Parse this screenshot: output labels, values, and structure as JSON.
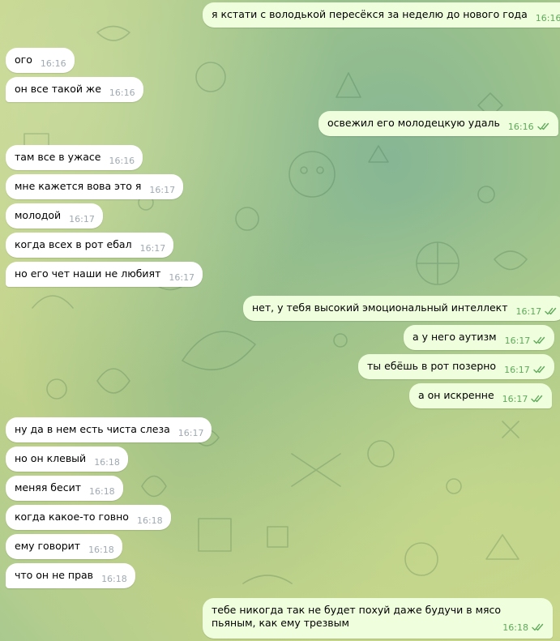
{
  "theme": {
    "incoming_bubble": "#ffffff",
    "outgoing_bubble": "#effedd",
    "incoming_time": "#a0aab2",
    "outgoing_time": "#5faa5a",
    "check_icon": "double-check-icon"
  },
  "messages": [
    {
      "dir": "out",
      "text": "я кстати с володькой пересёкся за неделю до нового года",
      "time": "16:16",
      "read": true
    },
    {
      "dir": "in",
      "text": "ого",
      "time": "16:16"
    },
    {
      "dir": "in",
      "text": "он все такой же",
      "time": "16:16"
    },
    {
      "dir": "out",
      "text": "освежил его молодецкую удаль",
      "time": "16:16",
      "read": true
    },
    {
      "dir": "in",
      "text": "там все в ужасе",
      "time": "16:16"
    },
    {
      "dir": "in",
      "text": "мне кажется вова это я",
      "time": "16:17"
    },
    {
      "dir": "in",
      "text": "молодой",
      "time": "16:17"
    },
    {
      "dir": "in",
      "text": "когда всех в рот ебал",
      "time": "16:17"
    },
    {
      "dir": "in",
      "text": "но его чет наши не любият",
      "time": "16:17"
    },
    {
      "dir": "out",
      "text": "нет, у тебя высокий эмоциональный интеллект",
      "time": "16:17",
      "read": true
    },
    {
      "dir": "out",
      "text": "а у него аутизм",
      "time": "16:17",
      "read": true
    },
    {
      "dir": "out",
      "text": "ты ебёшь в рот позерно",
      "time": "16:17",
      "read": true
    },
    {
      "dir": "out",
      "text": "а он искренне",
      "time": "16:17",
      "read": true
    },
    {
      "dir": "in",
      "text": "ну да в нем есть чиста слеза",
      "time": "16:17"
    },
    {
      "dir": "in",
      "text": "но он клевый",
      "time": "16:18"
    },
    {
      "dir": "in",
      "text": "меняя бесит",
      "time": "16:18"
    },
    {
      "dir": "in",
      "text": "когда какое-то говно",
      "time": "16:18"
    },
    {
      "dir": "in",
      "text": "ему говорит",
      "time": "16:18"
    },
    {
      "dir": "in",
      "text": "что он не прав",
      "time": "16:18"
    },
    {
      "dir": "out",
      "text": "тебе никогда так не будет похуй даже будучи в мясо пьяным, как ему трезвым",
      "time": "16:18",
      "read": true
    }
  ]
}
